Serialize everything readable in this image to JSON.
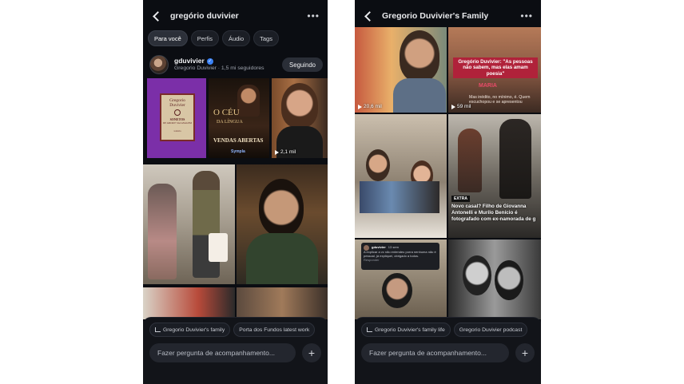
{
  "left": {
    "title": "gregório duvivier",
    "more_icon": "more-horizontal-icon",
    "tabs": [
      "Para você",
      "Perfis",
      "Áudio",
      "Tags"
    ],
    "profile": {
      "username": "gduvivier",
      "subtitle": "Gregorio Duvivier · 1,5 mi seguidores",
      "follow_label": "Seguindo"
    },
    "book": {
      "line1": "Gregorio",
      "line2": "Duvivier",
      "line3": "SONETOS",
      "line4": "DE AMOR E SACANAGEM",
      "publisher": "todavia"
    },
    "poster": {
      "line1": "O CÉU",
      "line2": "DA LÍNGUA",
      "line3": "VENDAS ABERTAS",
      "brand": "Sympla"
    },
    "video_views": "2,1 mil",
    "chips": [
      "Gregorio Duvivier's family",
      "Porta dos Fundos latest work"
    ],
    "input_placeholder": "Fazer pergunta de acompanhamento..."
  },
  "right": {
    "title": "Gregorio Duvivier's Family",
    "more_icon": "more-horizontal-icon",
    "views_1": "20,6 mil",
    "quote": "Gregório Duvivier: \"As pessoas não sabem, mas elas amam poesia\"",
    "maria": "MARIA",
    "sub_caption": "Mas inédito, no mínimo, é. Quem escuchopou e se apresentou",
    "views_2": "59 mil",
    "news_brand": "EXTRA",
    "news_headline": "Novo casal? Filho de Giovanna Antonelli e Murilo Benício é fotografado com ex-namorada de g",
    "comment_user": "gduvivier",
    "comment_time": "13 sem",
    "comment_text": "A explicar a vc não entendeu porra nenhuma não é pessoal, já expliquei, obrigado a todos.",
    "comment_reply": "Responder",
    "chips": [
      "Gregorio Duvivier's family life",
      "Gregorio Duvivier podcast"
    ],
    "input_placeholder": "Fazer pergunta de acompanhamento..."
  }
}
